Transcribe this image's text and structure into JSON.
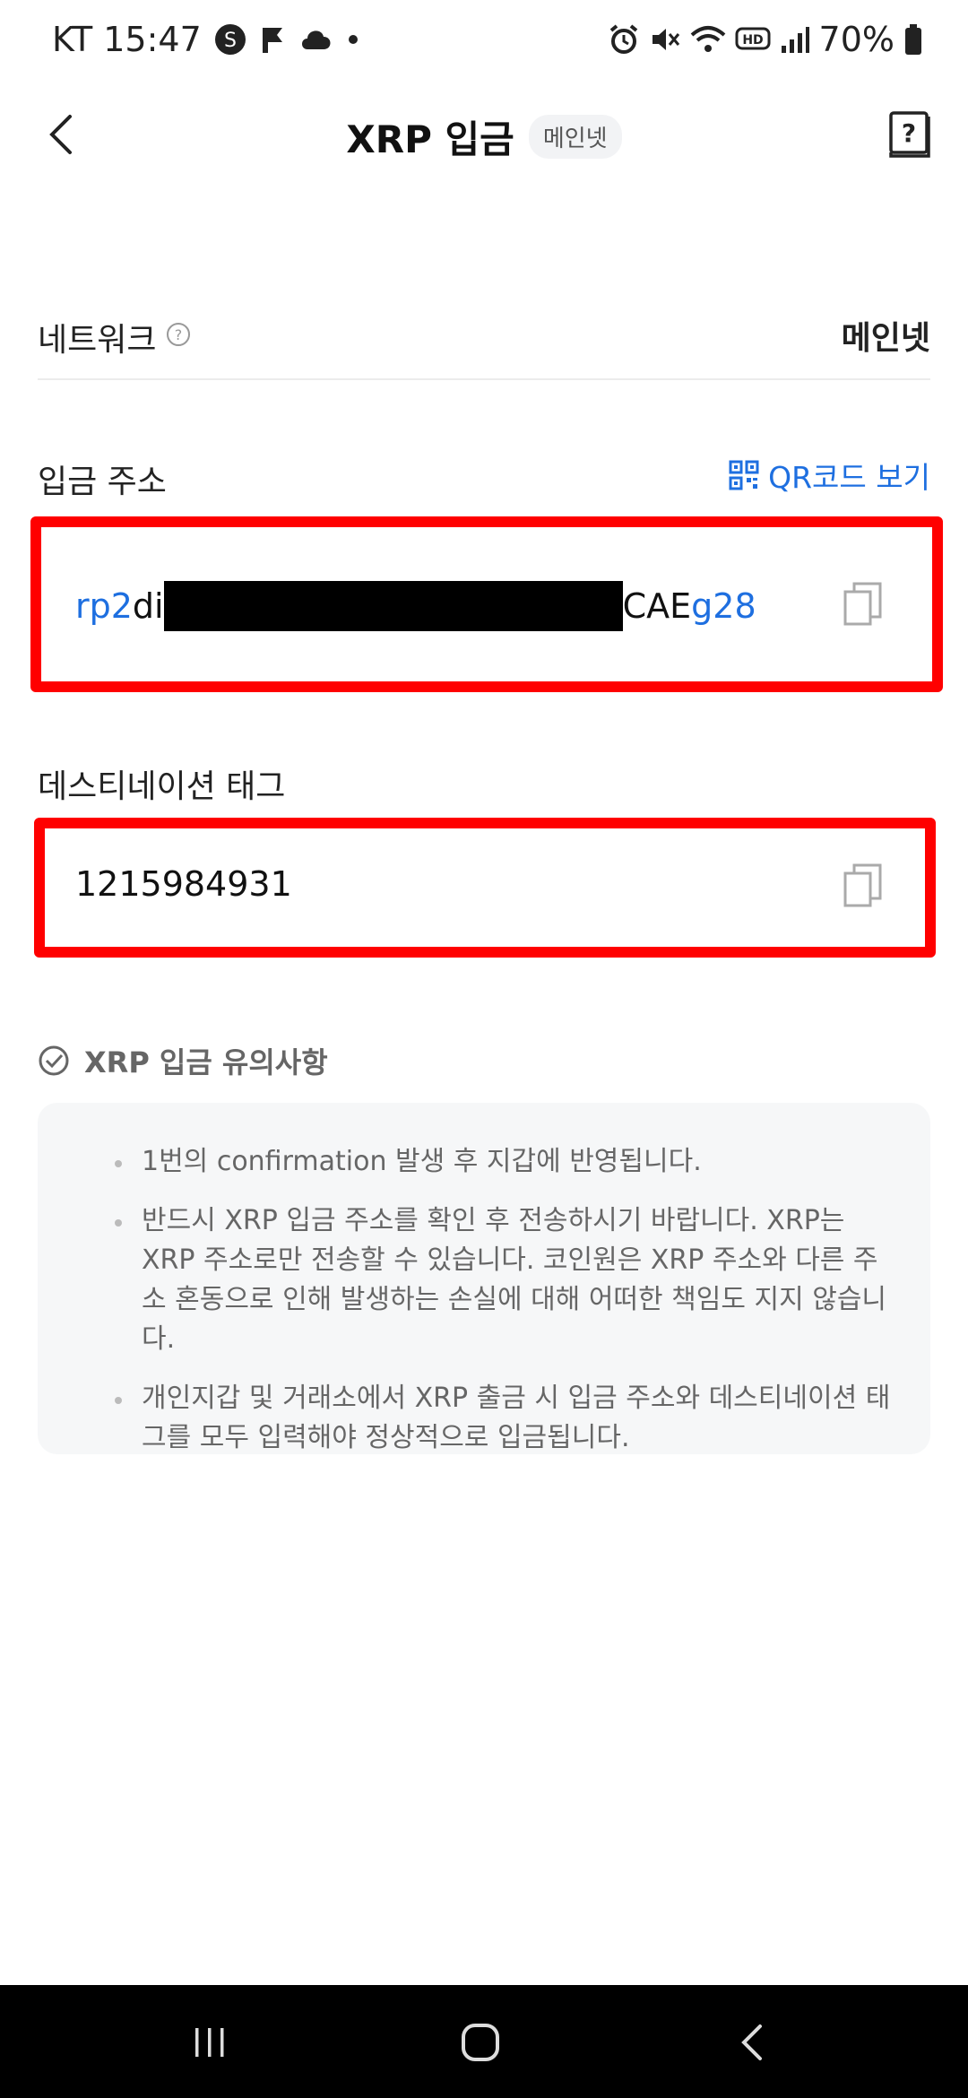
{
  "status_bar": {
    "carrier_time": "KT 15:47",
    "battery": "70%",
    "icons": [
      "s-icon",
      "flag-icon",
      "cloud-icon",
      "dot-icon",
      "alarm-icon",
      "mute-icon",
      "wifi-icon",
      "hd-icon",
      "signal-icon",
      "battery-icon"
    ]
  },
  "header": {
    "title": "XRP 입금",
    "badge": "메인넷"
  },
  "network": {
    "label": "네트워크",
    "value": "메인넷"
  },
  "address": {
    "label": "입금 주소",
    "qr_link": "QR코드 보기",
    "prefix_blue": "rp2",
    "prefix_dark": "di",
    "suffix_dark": "CAE",
    "suffix_blue": "g28"
  },
  "destination_tag": {
    "label": "데스티네이션 태그",
    "value": "1215984931"
  },
  "notice": {
    "title": "XRP 입금 유의사항",
    "items": [
      "1번의 confirmation 발생 후 지갑에 반영됩니다.",
      "반드시 XRP 입금 주소를 확인 후 전송하시기 바랍니다. XRP는 XRP 주소로만 전송할 수 있습니다. 코인원은 XRP 주소와 다른 주소 혼동으로 인해 발생하는 손실에 대해 어떠한 책임도 지지 않습니다.",
      "개인지갑 및 거래소에서 XRP 출금 시 입금 주소와 데스티네이션 태그를 모두 입력해야 정상적으로 입금됩니다."
    ]
  },
  "colors": {
    "accent_blue": "#1e6fe0",
    "highlight_red": "#ff0000"
  }
}
